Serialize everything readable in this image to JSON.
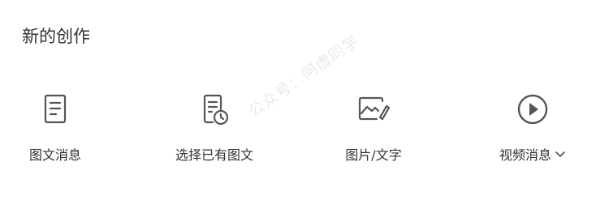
{
  "section": {
    "title": "新的创作"
  },
  "items": [
    {
      "label": "图文消息",
      "icon": "document-icon"
    },
    {
      "label": "选择已有图文",
      "icon": "document-clock-icon"
    },
    {
      "label": "图片/文字",
      "icon": "image-edit-icon"
    },
    {
      "label": "视频消息",
      "icon": "play-circle-icon",
      "has_dropdown": true
    }
  ],
  "watermark": "公众号：阿虚同学",
  "colors": {
    "text": "#333333",
    "icon": "#555555"
  }
}
